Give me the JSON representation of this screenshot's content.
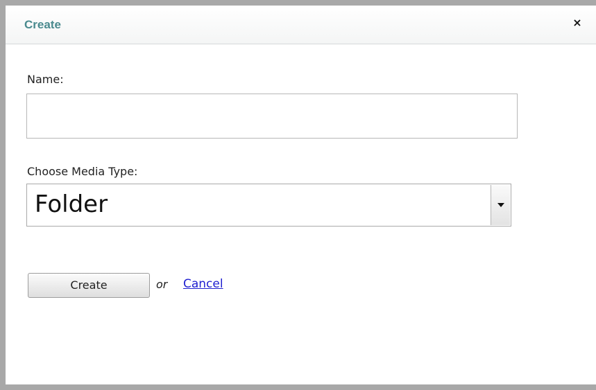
{
  "dialog": {
    "title": "Create",
    "close_glyph": "×",
    "close_icon": "close-icon"
  },
  "form": {
    "name_label": "Name:",
    "name_value": "",
    "media_type_label": "Choose Media Type:",
    "media_type_selected": "Folder",
    "dropdown_icon": "chevron-down-icon"
  },
  "actions": {
    "create_label": "Create",
    "or_text": "or",
    "cancel_label": "Cancel"
  },
  "colors": {
    "title": "#4a8a8e",
    "link": "#1f1fd0",
    "backdrop": "#a8a8a8"
  }
}
